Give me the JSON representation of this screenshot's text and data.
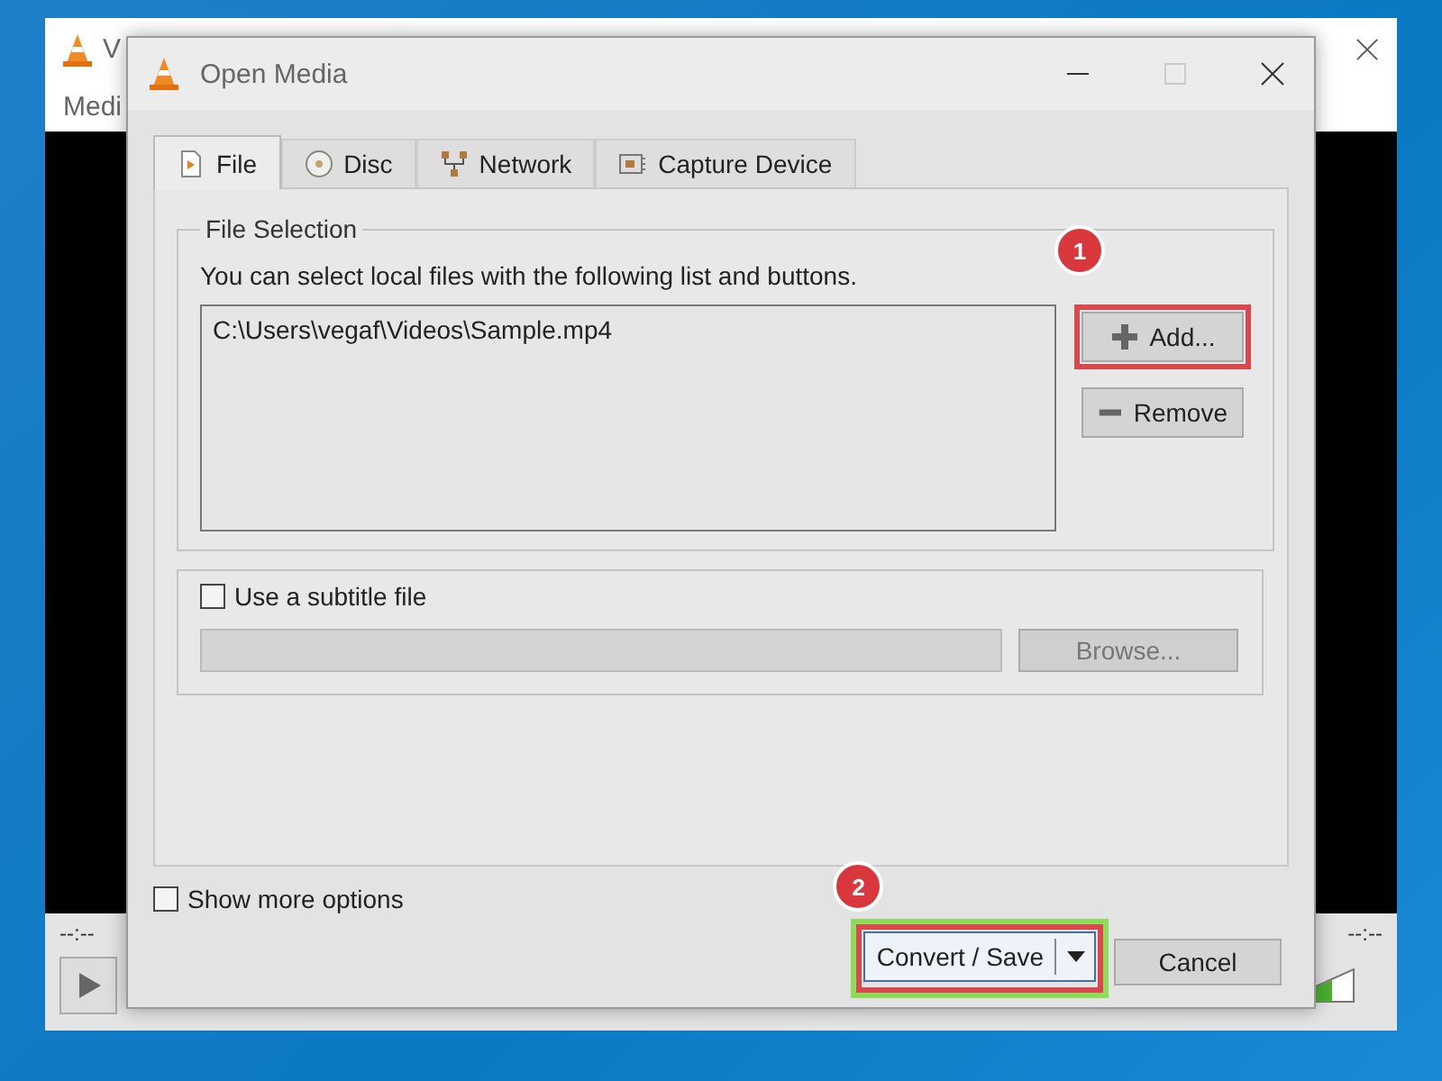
{
  "background_window": {
    "title": "V",
    "menu": [
      "Medi"
    ],
    "time_left": "--:--",
    "time_right": "--:--"
  },
  "dialog": {
    "title": "Open Media"
  },
  "tabs": [
    {
      "label": "File",
      "kind": "file",
      "selected": true
    },
    {
      "label": "Disc",
      "kind": "disc",
      "selected": false
    },
    {
      "label": "Network",
      "kind": "network",
      "selected": false
    },
    {
      "label": "Capture Device",
      "kind": "capture",
      "selected": false
    }
  ],
  "file_selection": {
    "title": "File Selection",
    "hint": "You can select local files with the following list and buttons.",
    "files": [
      "C:\\Users\\vegaf\\Videos\\Sample.mp4"
    ],
    "buttons": [
      {
        "label": "Add...",
        "kind": "add",
        "highlighted": true,
        "callout": "1"
      },
      {
        "label": "Remove",
        "kind": "remove",
        "highlighted": false
      }
    ]
  },
  "subtitle": {
    "label": "Use a subtitle file",
    "checked": false,
    "browse_label": "Browse..."
  },
  "show_more_options": {
    "label": "Show more options",
    "checked": false
  },
  "buttons": [
    {
      "label": "Convert / Save",
      "kind": "split",
      "highlighted": true,
      "callout": "2"
    },
    {
      "label": "Cancel",
      "kind": "plain",
      "highlighted": false
    }
  ]
}
